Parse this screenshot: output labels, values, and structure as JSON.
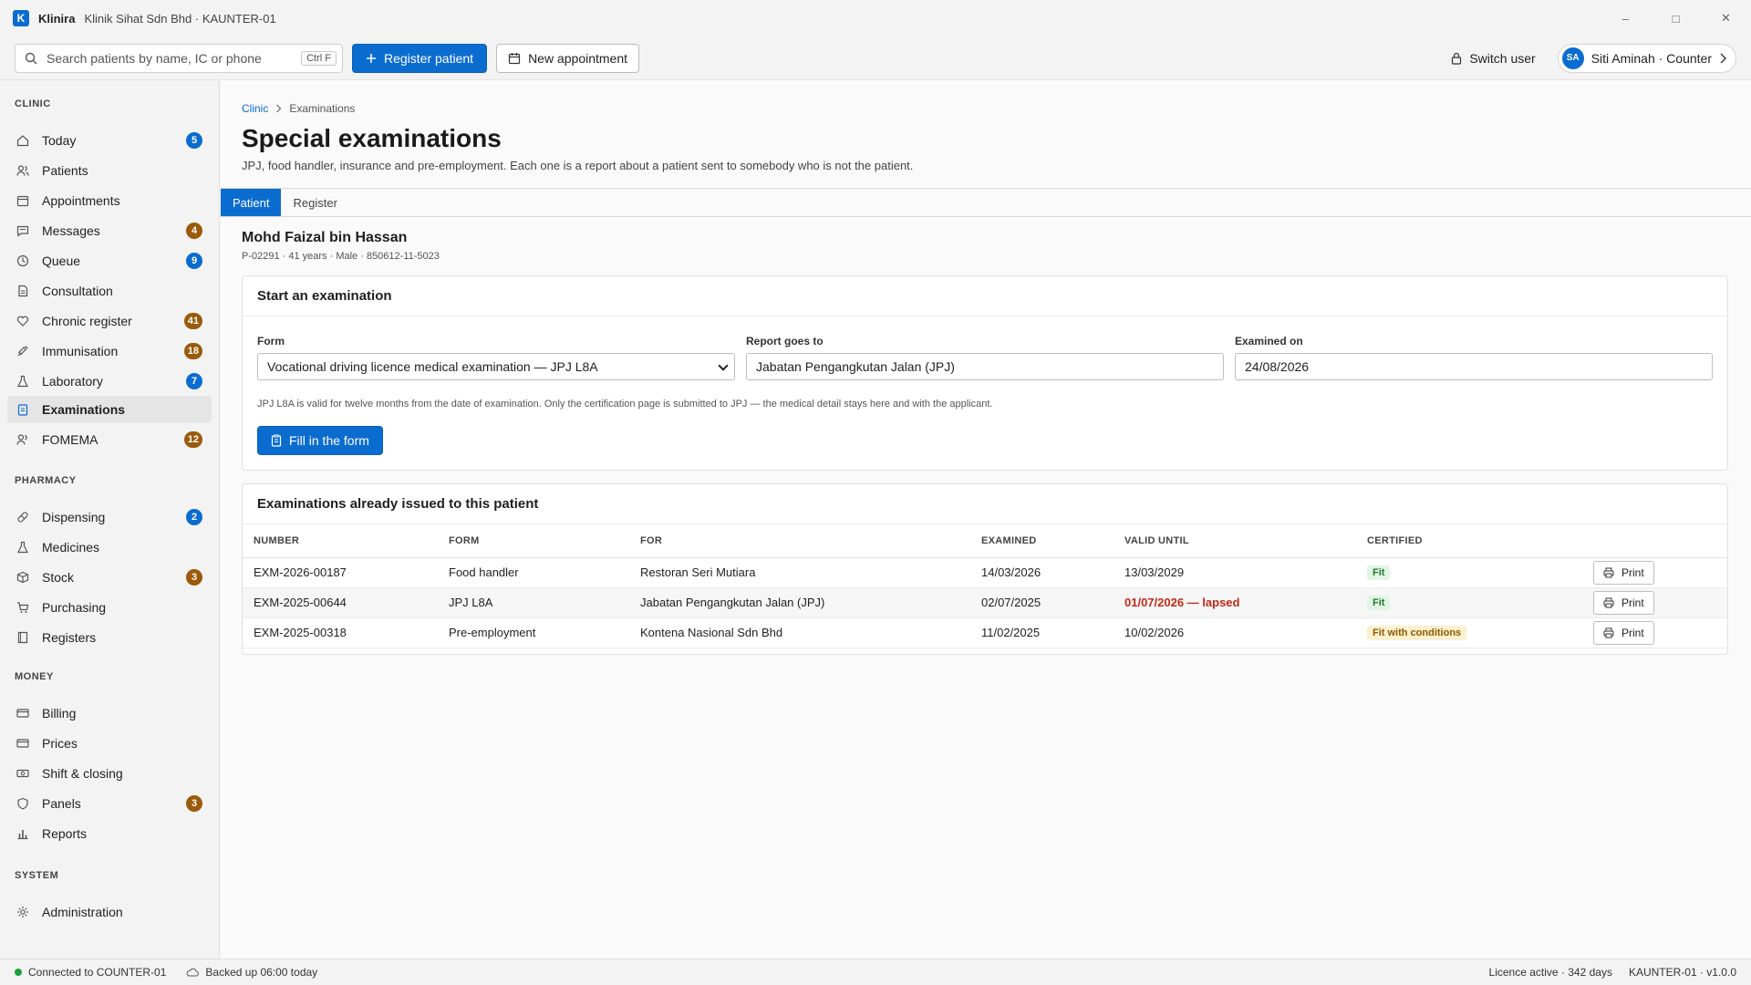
{
  "app": {
    "name": "Klinira",
    "logo_letter": "K",
    "subtitle": "Klinik Sihat Sdn Bhd · KAUNTER-01",
    "window_controls": {
      "minimize": "–",
      "maximize": "□",
      "close": "✕"
    }
  },
  "toolbar": {
    "search_placeholder": "Search patients by name, IC or phone",
    "search_shortcut": "Ctrl F",
    "register_label": "Register patient",
    "new_appointment_label": "New appointment",
    "switch_user_label": "Switch user",
    "user_initials": "SA",
    "user_label": "Siti Aminah · Counter"
  },
  "sidebar": {
    "sections": [
      {
        "label": "CLINIC",
        "items": [
          {
            "label": "Today",
            "icon": "home-icon",
            "badge": "5",
            "badge_color": "blue"
          },
          {
            "label": "Patients",
            "icon": "patients-icon"
          },
          {
            "label": "Appointments",
            "icon": "calendar-icon"
          },
          {
            "label": "Messages",
            "icon": "message-icon",
            "badge": "4",
            "badge_color": "amber"
          },
          {
            "label": "Queue",
            "icon": "clock-icon",
            "badge": "9",
            "badge_color": "blue"
          },
          {
            "label": "Consultation",
            "icon": "document-icon"
          },
          {
            "label": "Chronic register",
            "icon": "heart-icon",
            "badge": "41",
            "badge_color": "amber"
          },
          {
            "label": "Immunisation",
            "icon": "syringe-icon",
            "badge": "18",
            "badge_color": "amber"
          },
          {
            "label": "Laboratory",
            "icon": "flask-icon",
            "badge": "7",
            "badge_color": "blue"
          },
          {
            "label": "Examinations",
            "icon": "clipboard-icon",
            "active": true
          },
          {
            "label": "FOMEMA",
            "icon": "people-icon",
            "badge": "12",
            "badge_color": "amber"
          }
        ]
      },
      {
        "label": "PHARMACY",
        "items": [
          {
            "label": "Dispensing",
            "icon": "pill-icon",
            "badge": "2",
            "badge_color": "blue"
          },
          {
            "label": "Medicines",
            "icon": "flask-icon"
          },
          {
            "label": "Stock",
            "icon": "box-icon",
            "badge": "3",
            "badge_color": "amber"
          },
          {
            "label": "Purchasing",
            "icon": "cart-icon"
          },
          {
            "label": "Registers",
            "icon": "book-icon"
          }
        ]
      },
      {
        "label": "MONEY",
        "items": [
          {
            "label": "Billing",
            "icon": "card-icon"
          },
          {
            "label": "Prices",
            "icon": "card-icon"
          },
          {
            "label": "Shift & closing",
            "icon": "cash-icon"
          },
          {
            "label": "Panels",
            "icon": "shield-icon",
            "badge": "3",
            "badge_color": "amber"
          },
          {
            "label": "Reports",
            "icon": "bar-chart-icon"
          }
        ]
      },
      {
        "label": "SYSTEM",
        "items": [
          {
            "label": "Administration",
            "icon": "gear-icon"
          }
        ]
      }
    ]
  },
  "main": {
    "breadcrumb": {
      "root": "Clinic",
      "current": "Examinations"
    },
    "title": "Special examinations",
    "description": "JPJ, food handler, insurance and pre-employment. Each one is a report about a patient sent to somebody who is not the patient.",
    "tabs": [
      {
        "label": "Patient",
        "active": true
      },
      {
        "label": "Register"
      }
    ],
    "patient": {
      "name": "Mohd Faizal bin Hassan",
      "meta": "P-02291 · 41 years · Male · 850612-11-5023"
    },
    "start_card": {
      "title": "Start an examination",
      "form_label": "Form",
      "form_value": "Vocational driving licence medical examination — JPJ L8A",
      "report_label": "Report goes to",
      "report_value": "Jabatan Pengangkutan Jalan (JPJ)",
      "examined_label": "Examined on",
      "examined_value": "24/08/2026",
      "help": "JPJ L8A is valid for twelve months from the date of examination. Only the certification page is submitted to JPJ — the medical detail stays here and with the applicant.",
      "button": "Fill in the form"
    },
    "issued_card": {
      "title": "Examinations already issued to this patient",
      "columns": [
        "NUMBER",
        "FORM",
        "FOR",
        "EXAMINED",
        "VALID UNTIL",
        "CERTIFIED",
        ""
      ],
      "rows": [
        {
          "number": "EXM-2026-00187",
          "form": "Food handler",
          "for": "Restoran Seri Mutiara",
          "examined": "14/03/2026",
          "valid_until": "13/03/2029",
          "lapsed": false,
          "certified": "Fit",
          "certified_type": "fit",
          "action": "Print"
        },
        {
          "number": "EXM-2025-00644",
          "form": "JPJ L8A",
          "for": "Jabatan Pengangkutan Jalan (JPJ)",
          "examined": "02/07/2025",
          "valid_until": "01/07/2026 — lapsed",
          "lapsed": true,
          "certified": "Fit",
          "certified_type": "fit",
          "action": "Print"
        },
        {
          "number": "EXM-2025-00318",
          "form": "Pre-employment",
          "for": "Kontena Nasional Sdn Bhd",
          "examined": "11/02/2025",
          "valid_until": "10/02/2026",
          "lapsed": false,
          "certified": "Fit with conditions",
          "certified_type": "cond",
          "action": "Print"
        }
      ]
    }
  },
  "statusbar": {
    "connection": "Connected to COUNTER-01",
    "backup": "Backed up 06:00 today",
    "licence": "Licence active · 342 days",
    "version": "KAUNTER-01 · v1.0.0"
  }
}
